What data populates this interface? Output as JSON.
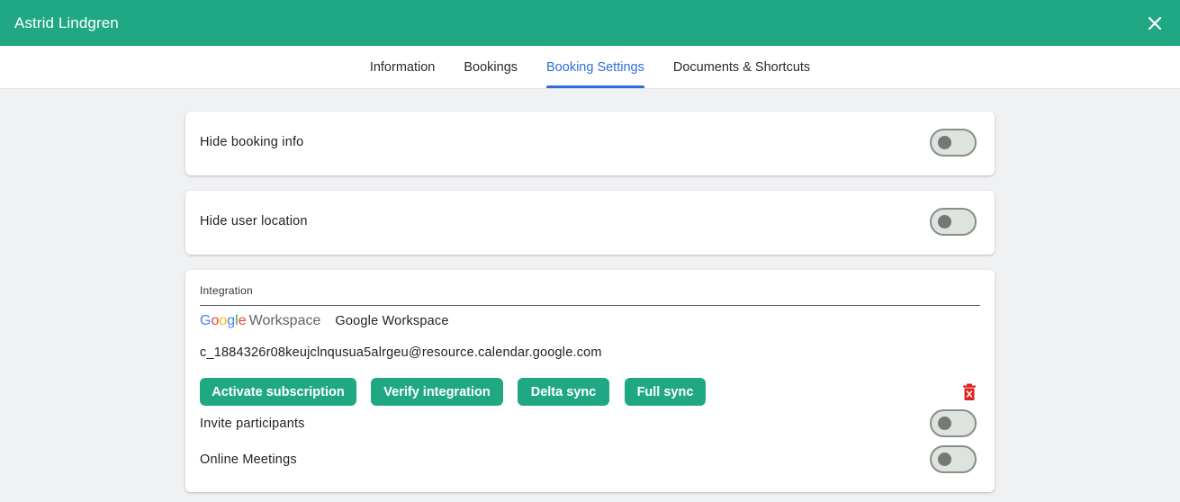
{
  "header": {
    "title": "Astrid Lindgren",
    "close_icon": "close-icon"
  },
  "tabs": [
    {
      "label": "Information",
      "active": false
    },
    {
      "label": "Bookings",
      "active": false
    },
    {
      "label": "Booking Settings",
      "active": true
    },
    {
      "label": "Documents & Shortcuts",
      "active": false
    }
  ],
  "settings": {
    "hide_booking_info": {
      "label": "Hide booking info",
      "enabled": false
    },
    "hide_user_location": {
      "label": "Hide user location",
      "enabled": false
    }
  },
  "integration": {
    "section_label": "Integration",
    "logo": {
      "brand": "Google",
      "product": "Workspace"
    },
    "provider_name": "Google Workspace",
    "resource_email": "c_1884326r08keujclnqusua5alrgeu@resource.calendar.google.com",
    "buttons": {
      "activate": "Activate subscription",
      "verify": "Verify integration",
      "delta": "Delta sync",
      "full": "Full sync"
    },
    "delete_icon": "trash-icon",
    "invite_participants": {
      "label": "Invite participants",
      "enabled": false
    },
    "online_meetings": {
      "label": "Online Meetings",
      "enabled": false
    }
  },
  "colors": {
    "primary": "#20a884",
    "tab_active": "#2f6fd6",
    "danger": "#e02020",
    "google_blue": "#4285F4",
    "google_red": "#EA4335",
    "google_yellow": "#FBBC05",
    "google_green": "#34A853"
  }
}
